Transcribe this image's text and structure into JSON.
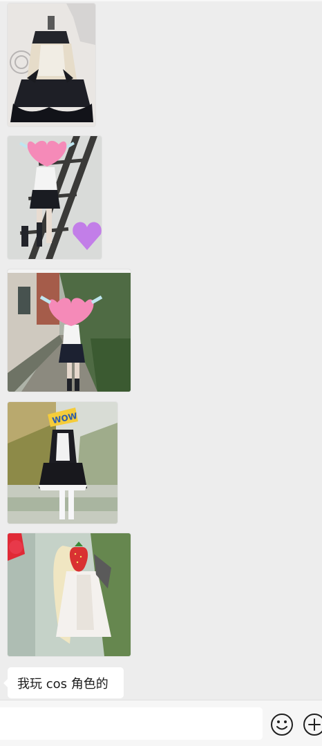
{
  "chat": {
    "images": [
      {
        "name": "maid-costume-photo"
      },
      {
        "name": "schoolgirl-ladder-photo"
      },
      {
        "name": "schoolgirl-street-photo"
      },
      {
        "name": "maid-outdoor-photo"
      },
      {
        "name": "white-wig-photo"
      }
    ],
    "last_message": "我玩 cos 角色的"
  },
  "input_bar": {
    "placeholder": "",
    "value": "",
    "emoji_icon": "emoji-icon",
    "more_icon": "plus-circle-icon"
  },
  "colors": {
    "background": "#ededed",
    "bubble": "#ffffff",
    "input_bar": "#f6f6f6"
  }
}
